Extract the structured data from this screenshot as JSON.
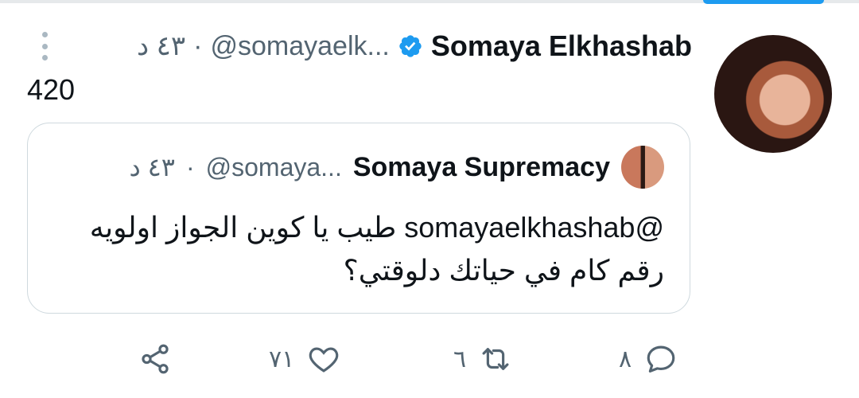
{
  "tweet": {
    "author_name": "Somaya Elkhashab",
    "handle": "@somayaelk...",
    "separator": "·",
    "time": "٤٣ د",
    "text": "420"
  },
  "quote": {
    "author_name": "Somaya Supremacy",
    "handle": "@somaya...",
    "separator": "·",
    "time": "٤٣ د",
    "text_line1": "@somayaelkhashab طيب يا كوين الجواز اولويه",
    "text_line2": "رقم كام في حياتك دلوقتي؟"
  },
  "actions": {
    "reply_count": "٨",
    "retweet_count": "٦",
    "like_count": "٧١"
  },
  "icons": {
    "verified": "verified-badge-icon",
    "menu": "more-menu-icon",
    "reply": "reply-icon",
    "retweet": "retweet-icon",
    "like": "heart-icon",
    "share": "share-icon"
  },
  "colors": {
    "accent": "#1d9bf0",
    "muted": "#536471"
  }
}
